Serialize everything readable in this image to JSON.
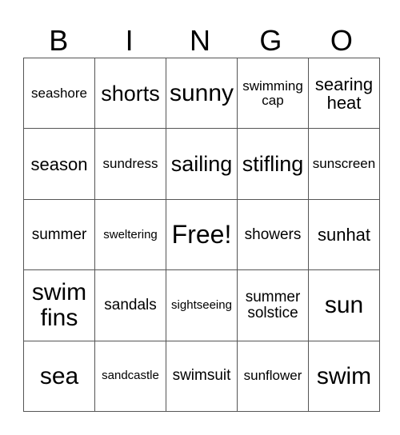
{
  "header": [
    "B",
    "I",
    "N",
    "G",
    "O"
  ],
  "rows": [
    [
      "seashore",
      "shorts",
      "sunny",
      "swimming cap",
      "searing heat"
    ],
    [
      "season",
      "sundress",
      "sailing",
      "stifling",
      "sunscreen"
    ],
    [
      "summer",
      "sweltering",
      "Free!",
      "showers",
      "sunhat"
    ],
    [
      "swim fins",
      "sandals",
      "sightseeing",
      "summer solstice",
      "sun"
    ],
    [
      "sea",
      "sandcastle",
      "swimsuit",
      "sunflower",
      "swim"
    ]
  ]
}
